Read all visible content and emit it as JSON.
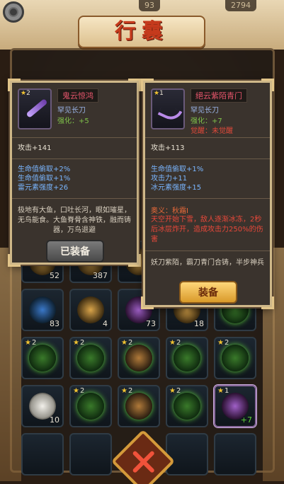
{
  "topbar": {
    "left_value": "93",
    "right_value": "2794"
  },
  "title": "行囊",
  "grid": {
    "rows": [
      [
        {
          "stars": "",
          "count": "52"
        },
        {
          "stars": "",
          "count": "387"
        },
        {
          "stars": "",
          "count": ""
        },
        {
          "stars": "",
          "count": ""
        },
        {
          "stars": "",
          "count": ""
        }
      ],
      [
        {
          "stars": "",
          "count": "83"
        },
        {
          "stars": "",
          "count": "4"
        },
        {
          "stars": "",
          "count": "73"
        },
        {
          "stars": "",
          "count": "18"
        },
        {
          "stars": "",
          "count": ""
        }
      ],
      [
        {
          "stars": "2",
          "count": ""
        },
        {
          "stars": "2",
          "count": ""
        },
        {
          "stars": "2",
          "count": ""
        },
        {
          "stars": "2",
          "count": ""
        },
        {
          "stars": "2",
          "count": ""
        }
      ],
      [
        {
          "stars": "",
          "count": "10"
        },
        {
          "stars": "2",
          "count": ""
        },
        {
          "stars": "2",
          "count": ""
        },
        {
          "stars": "2",
          "count": ""
        },
        {
          "stars": "1",
          "count": "+7"
        }
      ]
    ]
  },
  "left_panel": {
    "stars": "2",
    "name": "鬼云惊鸿",
    "type": "罕见长刀",
    "enhance": "强化：+5",
    "attack": "攻击+141",
    "attrs": [
      "生命值偷取+2%",
      "生命值偷取+1%",
      "雷元素强度+26"
    ],
    "desc": "极地有大鱼，口吐长河，眼如璀星，无鸟能食。大鱼脊骨含神铁，融而铸器，万鸟退避",
    "button": "已装备"
  },
  "right_panel": {
    "stars": "1",
    "name": "絕云紫陌青门",
    "type": "罕见长刀",
    "enhance": "强化：+7",
    "awaken": "觉醒：未觉醒",
    "attack": "攻击+113",
    "attrs": [
      "生命值偷取+1%",
      "攻击力+11",
      "冰元素强度+15"
    ],
    "skill_name": "奥义：秋霜I",
    "skill_desc": "天空开始下雪，敌人逐渐冰冻，2秒后冰层炸开，造成攻击力250%的伤害",
    "desc": "妖刀紫陌，霸刀青门合铸，半步神兵",
    "button": "装备"
  }
}
